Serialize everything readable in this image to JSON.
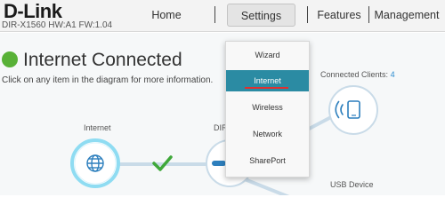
{
  "brand": {
    "logo": "D-Link",
    "model": "DIR-X1560 HW:A1 FW:1.04"
  },
  "nav": {
    "home": "Home",
    "settings": "Settings",
    "features": "Features",
    "management": "Management"
  },
  "settings_menu": {
    "items": [
      "Wizard",
      "Internet",
      "Wireless",
      "Network",
      "SharePort"
    ],
    "active": "Internet"
  },
  "status": {
    "title": "Internet Connected",
    "instruction": "Click on any item in the diagram for more information.",
    "indicator_color": "#58b137"
  },
  "diagram": {
    "internet_label": "Internet",
    "router_label": "DIR",
    "clients_label": "Connected Clients:",
    "clients_count": "4",
    "usb_label": "USB Device",
    "connection_status_icon": "checkmark-icon"
  },
  "colors": {
    "accent": "#2b8ba3",
    "active_underline": "#e03030",
    "node_glow": "#6fd0ec",
    "connection_line": "#c9dbe8"
  }
}
